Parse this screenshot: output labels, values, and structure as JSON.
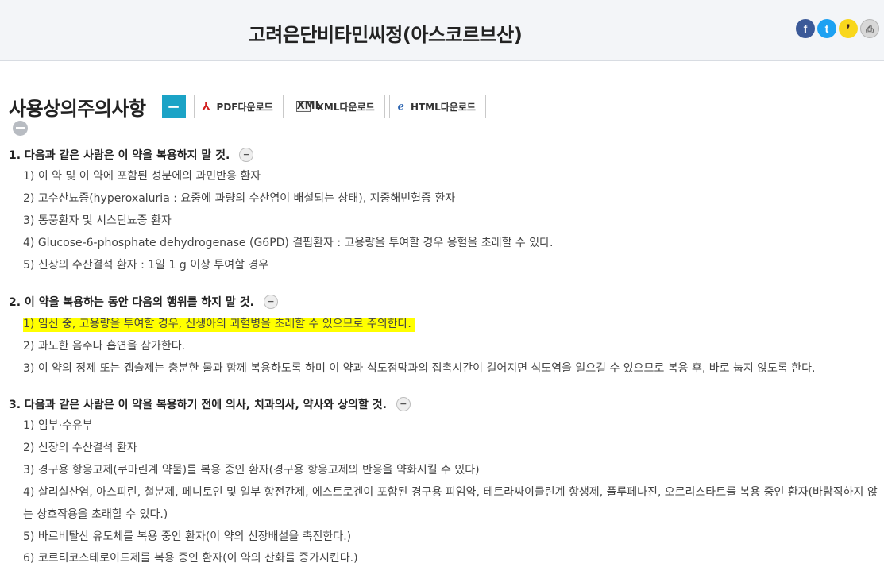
{
  "header": {
    "drug_title": "고려은단비타민씨정(아스코르브산)",
    "share_icons": [
      "facebook-icon",
      "twitter-icon",
      "kakaostory-icon",
      "print-icon"
    ]
  },
  "section": {
    "title": "사용상의주의사항",
    "collapse_label": "−",
    "downloads": [
      {
        "label": "PDF다운로드",
        "icon": "pdf-icon"
      },
      {
        "label": "XML다운로드",
        "icon": "xml-icon"
      },
      {
        "label": "HTML다운로드",
        "icon": "html-icon"
      }
    ]
  },
  "groups": [
    {
      "heading": "1. 다음과 같은 사람은 이 약을 복용하지 말 것.",
      "items": [
        "1) 이 약 및 이 약에 포함된 성분에의 과민반응 환자",
        "2) 고수산뇨증(hyperoxaluria : 요중에 과량의 수산염이 배설되는 상태), 지중해빈혈증 환자",
        "3) 통풍환자 및 시스틴뇨증 환자",
        "4) Glucose-6-phosphate dehydrogenase (G6PD) 결핍환자 : 고용량을 투여할 경우 용혈을 초래할 수 있다.",
        "5) 신장의 수산결석 환자 : 1일 1 g 이상 투여할 경우"
      ]
    },
    {
      "heading": "2. 이 약을 복용하는 동안 다음의 행위를 하지 말 것.",
      "items": [
        "1) 임신 중, 고용량을 투여할 경우, 신생아의 괴혈병을 초래할 수 있으므로 주의한다.",
        "2) 과도한 음주나 흡연을 삼가한다.",
        "3) 이 약의 정제 또는 캡슐제는 충분한 물과 함께 복용하도록 하며 이 약과 식도점막과의 접촉시간이 길어지면 식도염을 일으킬 수 있으므로 복용 후, 바로 눕지 않도록 한다."
      ]
    },
    {
      "heading": "3. 다음과 같은 사람은 이 약을 복용하기 전에 의사, 치과의사, 약사와 상의할 것.",
      "items": [
        "1) 임부·수유부",
        "2) 신장의 수산결석 환자",
        "3) 경구용 항응고제(쿠마린계 약물)를 복용 중인 환자(경구용 항응고제의 반응을 약화시킬 수 있다)",
        "4) 살리실산염, 아스피린, 철분제, 페니토인 및 일부 항전간제, 에스트로겐이 포함된 경구용 피임약, 테트라싸이클린계 항생제, 플루페나진, 오르리스타트를 복용 중인 환자(바람직하지 않는 상호작용을 초래할 수 있다.)",
        "5) 바르비탈산 유도체를 복용 중인 환자(이 약의 신장배설을 촉진한다.)",
        "6) 코르티코스테로이드제를 복용 중인 환자(이 약의 산화를 증가시킨다.)"
      ]
    }
  ],
  "toggle_label": "−"
}
